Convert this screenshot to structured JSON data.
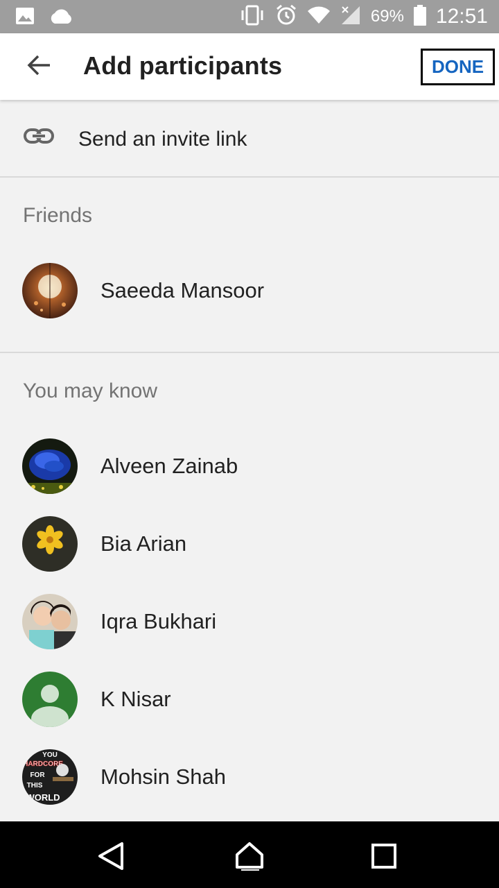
{
  "status_bar": {
    "battery_percent": "69%",
    "time": "12:51",
    "icons": [
      "image-icon",
      "cloud-icon",
      "vibrate-icon",
      "alarm-icon",
      "wifi-icon",
      "signal-icon",
      "battery-icon"
    ]
  },
  "app_bar": {
    "title": "Add participants",
    "done_label": "DONE",
    "back_icon": "arrow-back-icon"
  },
  "invite": {
    "label": "Send an invite link",
    "icon": "link-icon"
  },
  "friends": {
    "header": "Friends",
    "people": [
      {
        "name": "Saeeda Mansoor"
      }
    ]
  },
  "suggestions": {
    "header": "You may know",
    "people": [
      {
        "name": "Alveen Zainab"
      },
      {
        "name": "Bia Arian"
      },
      {
        "name": "Iqra Bukhari"
      },
      {
        "name": "K Nisar"
      },
      {
        "name": "Mohsin Shah"
      }
    ]
  },
  "avatar_art": {
    "mohsin_lines": [
      "YOU",
      "HARDCORE",
      "FOR",
      "THIS",
      "WORLD"
    ]
  },
  "colors": {
    "accent": "#1565c0",
    "default_avatar_bg": "#2e7d32",
    "status_bar_bg": "#9e9e9e"
  },
  "nav_bar": {
    "icons": [
      "back-triangle-icon",
      "home-icon",
      "recents-square-icon"
    ]
  }
}
